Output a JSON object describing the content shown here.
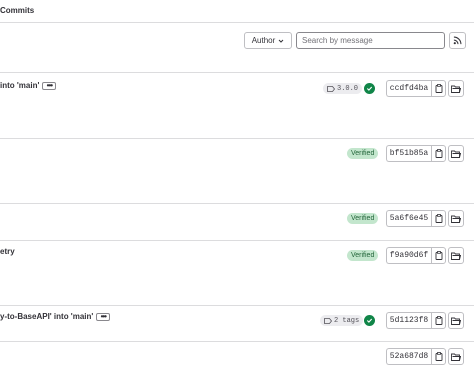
{
  "breadcrumb": "Commits",
  "filters": {
    "author_label": "Author",
    "search_placeholder": "Search by message"
  },
  "commits": [
    {
      "title": "into 'main'",
      "has_ellipsis": true,
      "tag": "3.0.0",
      "status": "pipeline-success",
      "sha": "ccdfd4ba"
    },
    {
      "title": "",
      "has_ellipsis": false,
      "badge": "Verified",
      "sha": "bf51b85a"
    },
    {
      "title": "",
      "has_ellipsis": false,
      "badge": "Verified",
      "sha": "5a6f6e45"
    },
    {
      "title": "etry",
      "has_ellipsis": false,
      "badge": "Verified",
      "sha": "f9a90d6f"
    },
    {
      "title": "y-to-BaseAPI' into 'main'",
      "has_ellipsis": true,
      "tag": "2 tags",
      "status": "pipeline-success",
      "sha": "5d1123f8"
    },
    {
      "title": "",
      "has_ellipsis": false,
      "sha": "52a687d8"
    }
  ],
  "colors": {
    "verified_bg": "#c3e6cd",
    "verified_text": "#24663b",
    "pipeline_success": "#108548",
    "border": "#dcdcde"
  }
}
